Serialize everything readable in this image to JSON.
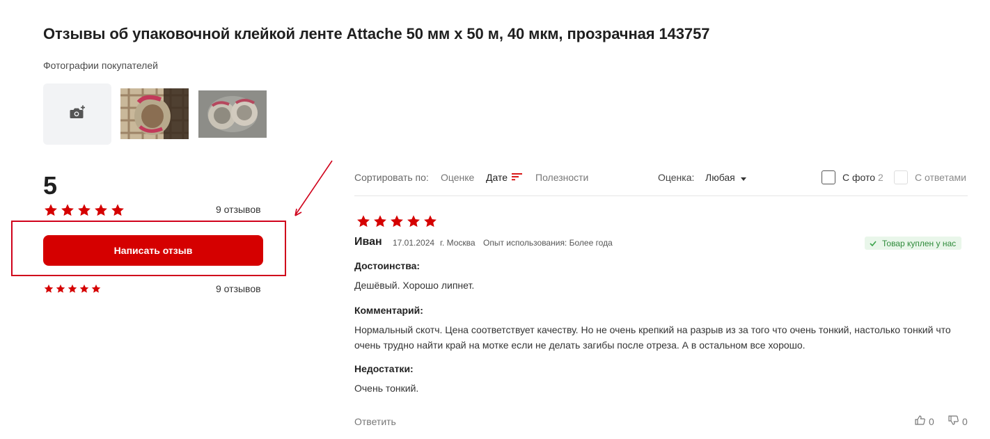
{
  "page": {
    "title": "Отзывы об упаковочной клейкой ленте Attache 50 мм х 50 м, 40 мкм, прозрачная 143757",
    "photos_label": "Фотографии покупателей"
  },
  "summary": {
    "rating": "5",
    "stars_filled": 5,
    "reviews_count_text": "9 отзывов",
    "write_button_label": "Написать отзыв",
    "breakdown": [
      {
        "stars": 5,
        "count_text": "9 отзывов"
      }
    ]
  },
  "toolbar": {
    "sort_label": "Сортировать по:",
    "sort_options": [
      "Оценке",
      "Дате",
      "Полезности"
    ],
    "sort_active": "Дате",
    "rating_label": "Оценка:",
    "rating_value": "Любая",
    "filter_with_photo": "С фото",
    "filter_with_photo_count": "2",
    "filter_with_answers": "С ответами"
  },
  "review": {
    "stars": 5,
    "author": "Иван",
    "date": "17.01.2024",
    "city": "г. Москва",
    "experience": "Опыт использования: Более года",
    "badge": "Товар куплен у нас",
    "pros_heading": "Достоинства:",
    "pros_text": "Дешёвый. Хорошо липнет.",
    "comment_heading": "Комментарий:",
    "comment_text": "Нормальный скотч. Цена соответствует качеству. Но не очень крепкий на разрыв из за того что очень тонкий, настолько тонкий что очень трудно найти край на мотке если не делать загибы после отреза. А в остальном все хорошо.",
    "cons_heading": "Недостатки:",
    "cons_text": "Очень тонкий.",
    "reply_label": "Ответить",
    "likes": "0",
    "dislikes": "0"
  },
  "colors": {
    "accent": "#d50000",
    "star": "#d50000",
    "badge_bg": "#e9f6ea",
    "badge_text": "#2e8b3a"
  },
  "icons": [
    "camera-plus-icon",
    "star-icon",
    "sort-desc-icon",
    "caret-down-icon",
    "check-icon",
    "thumb-up-icon",
    "thumb-down-icon"
  ]
}
